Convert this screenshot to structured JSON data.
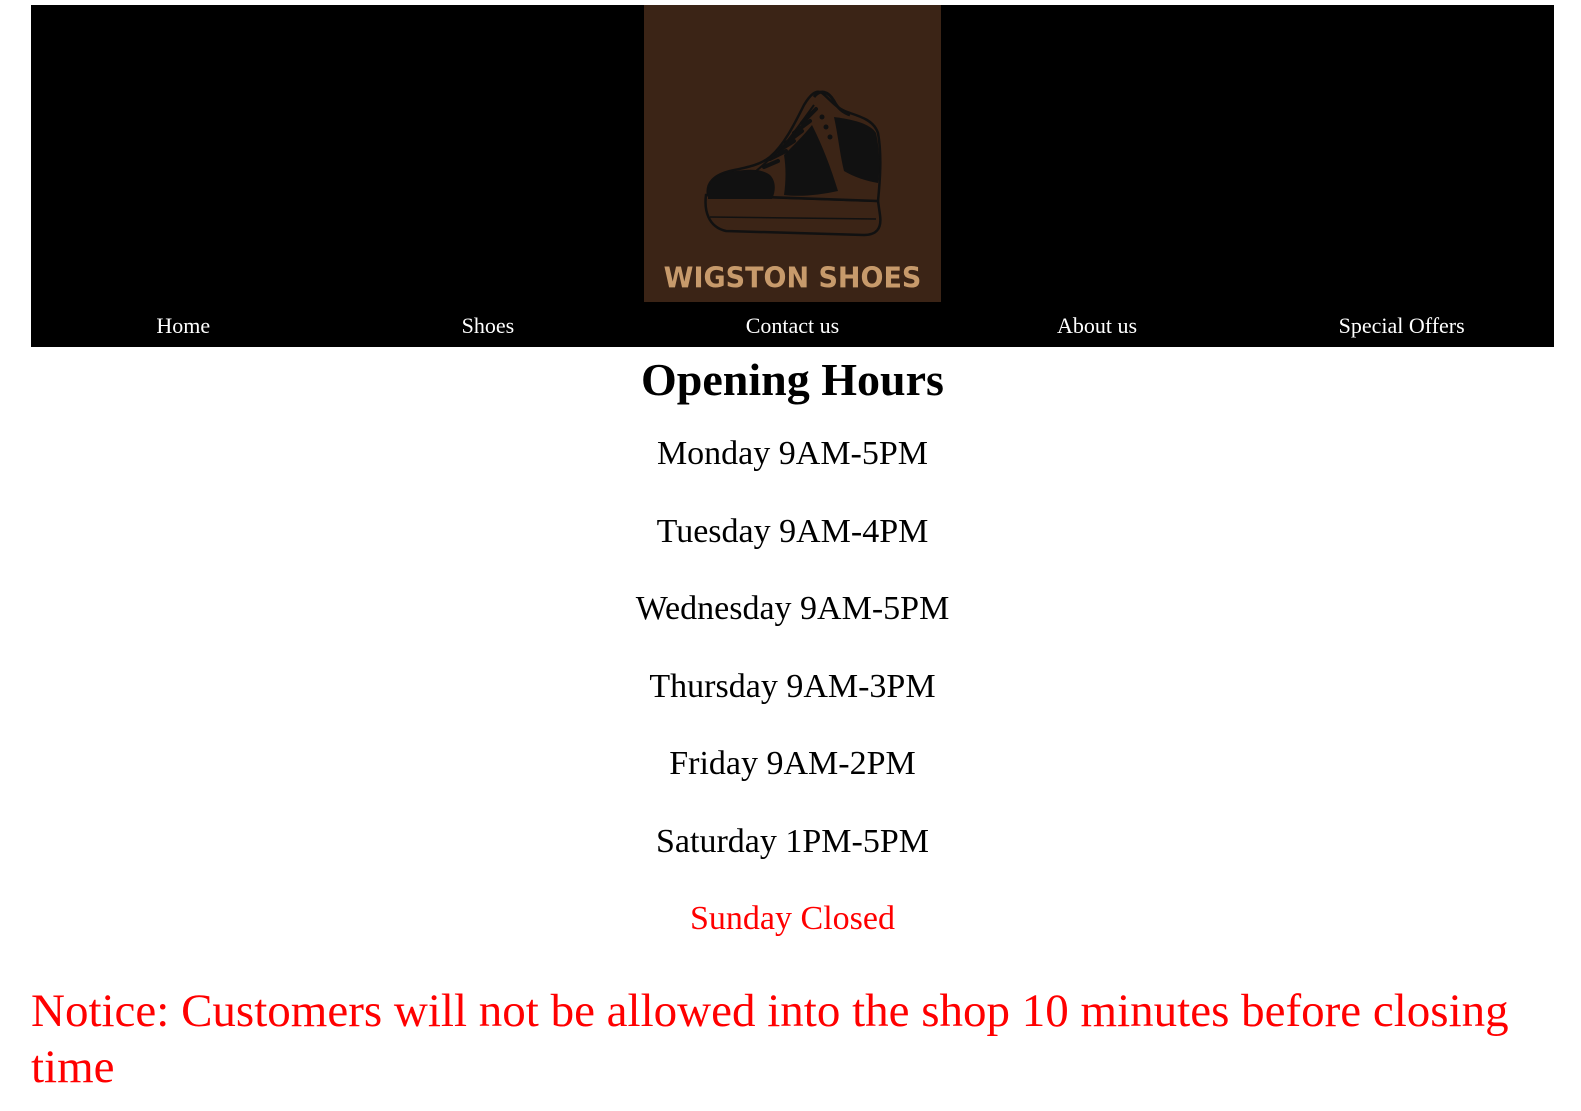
{
  "logo": {
    "text": "WIGSTON SHOES",
    "icon": "sneaker-icon",
    "background": "#3b2416",
    "text_color": "#c79a6b"
  },
  "nav": {
    "items": [
      {
        "label": "Home"
      },
      {
        "label": "Shoes"
      },
      {
        "label": "Contact us"
      },
      {
        "label": "About us"
      },
      {
        "label": "Special Offers"
      }
    ]
  },
  "main": {
    "title": "Opening Hours",
    "hours": [
      {
        "text": "Monday 9AM-5PM"
      },
      {
        "text": "Tuesday 9AM-4PM"
      },
      {
        "text": "Wednesday 9AM-5PM"
      },
      {
        "text": "Thursday 9AM-3PM"
      },
      {
        "text": "Friday 9AM-2PM"
      },
      {
        "text": "Saturday 1PM-5PM"
      },
      {
        "text": "Sunday Closed"
      }
    ],
    "notice": "Notice: Customers will not be allowed into the shop 10 minutes before closing time"
  },
  "colors": {
    "header_bg": "#000000",
    "nav_text": "#ffffff",
    "alert": "#ff0000"
  }
}
